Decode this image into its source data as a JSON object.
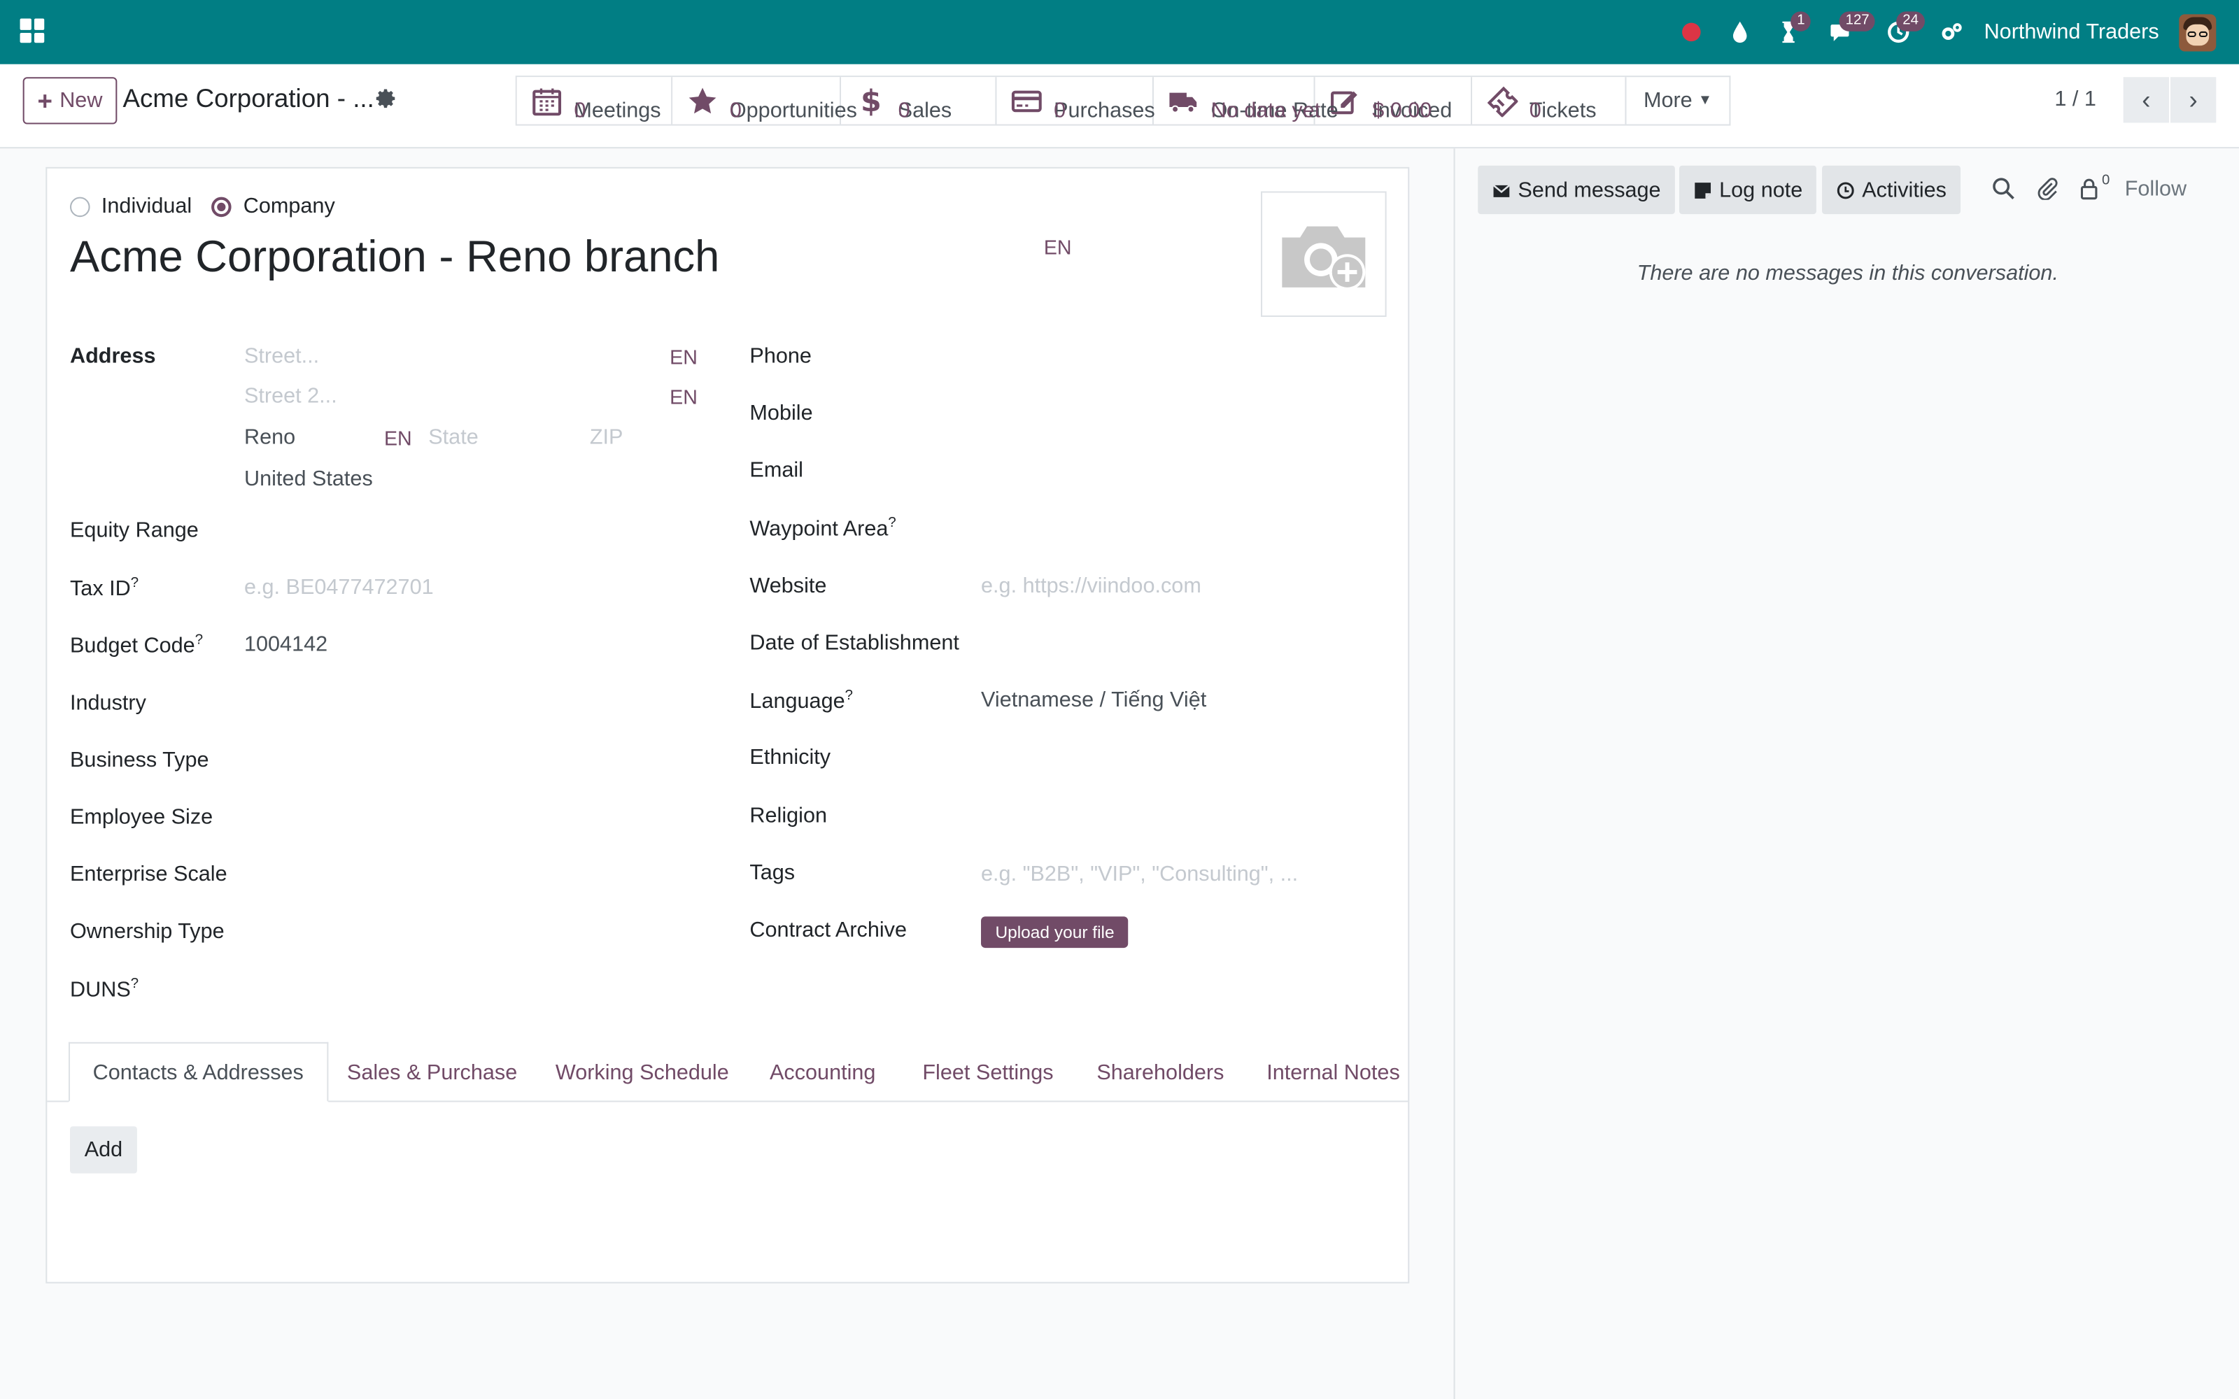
{
  "navbar": {
    "company": "Northwind Traders",
    "activity_badge": "1",
    "messages_badge": "127",
    "clock_badge": "24"
  },
  "control": {
    "new_label": "New",
    "breadcrumb": "Acme Corporation - ...",
    "pager": "1 / 1",
    "more_label": "More",
    "smart_buttons": [
      {
        "label": "Meetings",
        "value": "0"
      },
      {
        "label": "Opportunities",
        "value": "0"
      },
      {
        "label": "Sales",
        "value": "0"
      },
      {
        "label": "Purchases",
        "value": "0"
      },
      {
        "label": "On-time Rate",
        "value": "No data yet"
      },
      {
        "label": "Invoiced",
        "value": "$ 0.00"
      },
      {
        "label": "Tickets",
        "value": "0"
      }
    ]
  },
  "form": {
    "type_individual": "Individual",
    "type_company": "Company",
    "name": "Acme Corporation - Reno branch",
    "lang_tag": "EN",
    "address_label": "Address",
    "street_placeholder": "Street...",
    "street2_placeholder": "Street 2...",
    "city": "Reno",
    "state_placeholder": "State",
    "zip_placeholder": "ZIP",
    "country": "United States",
    "left_fields": {
      "equity_range": "Equity Range",
      "tax_id": "Tax ID",
      "tax_id_placeholder": "e.g. BE0477472701",
      "budget_code": "Budget Code",
      "budget_code_value": "1004142",
      "industry": "Industry",
      "business_type": "Business Type",
      "employee_size": "Employee Size",
      "enterprise_scale": "Enterprise Scale",
      "ownership_type": "Ownership Type",
      "duns": "DUNS"
    },
    "right_fields": {
      "phone": "Phone",
      "mobile": "Mobile",
      "email": "Email",
      "waypoint_area": "Waypoint Area",
      "website": "Website",
      "website_placeholder": "e.g. https://viindoo.com",
      "date_of_establishment": "Date of Establishment",
      "language": "Language",
      "language_value": "Vietnamese / Tiếng Việt",
      "ethnicity": "Ethnicity",
      "religion": "Religion",
      "tags": "Tags",
      "tags_placeholder": "e.g. \"B2B\", \"VIP\", \"Consulting\", ...",
      "contract_archive": "Contract Archive",
      "upload_label": "Upload your file"
    },
    "help_mark": "?",
    "tabs": [
      "Contacts & Addresses",
      "Sales & Purchase",
      "Working Schedule",
      "Accounting",
      "Fleet Settings",
      "Shareholders",
      "Internal Notes"
    ],
    "add_label": "Add"
  },
  "chatter": {
    "send_message": "Send message",
    "log_note": "Log note",
    "activities": "Activities",
    "follower_count": "0",
    "follow": "Follow",
    "empty": "There are no messages in this conversation."
  },
  "colors": {
    "navbar": "#017e84",
    "accent": "#714b67",
    "badge": "#714b67"
  }
}
